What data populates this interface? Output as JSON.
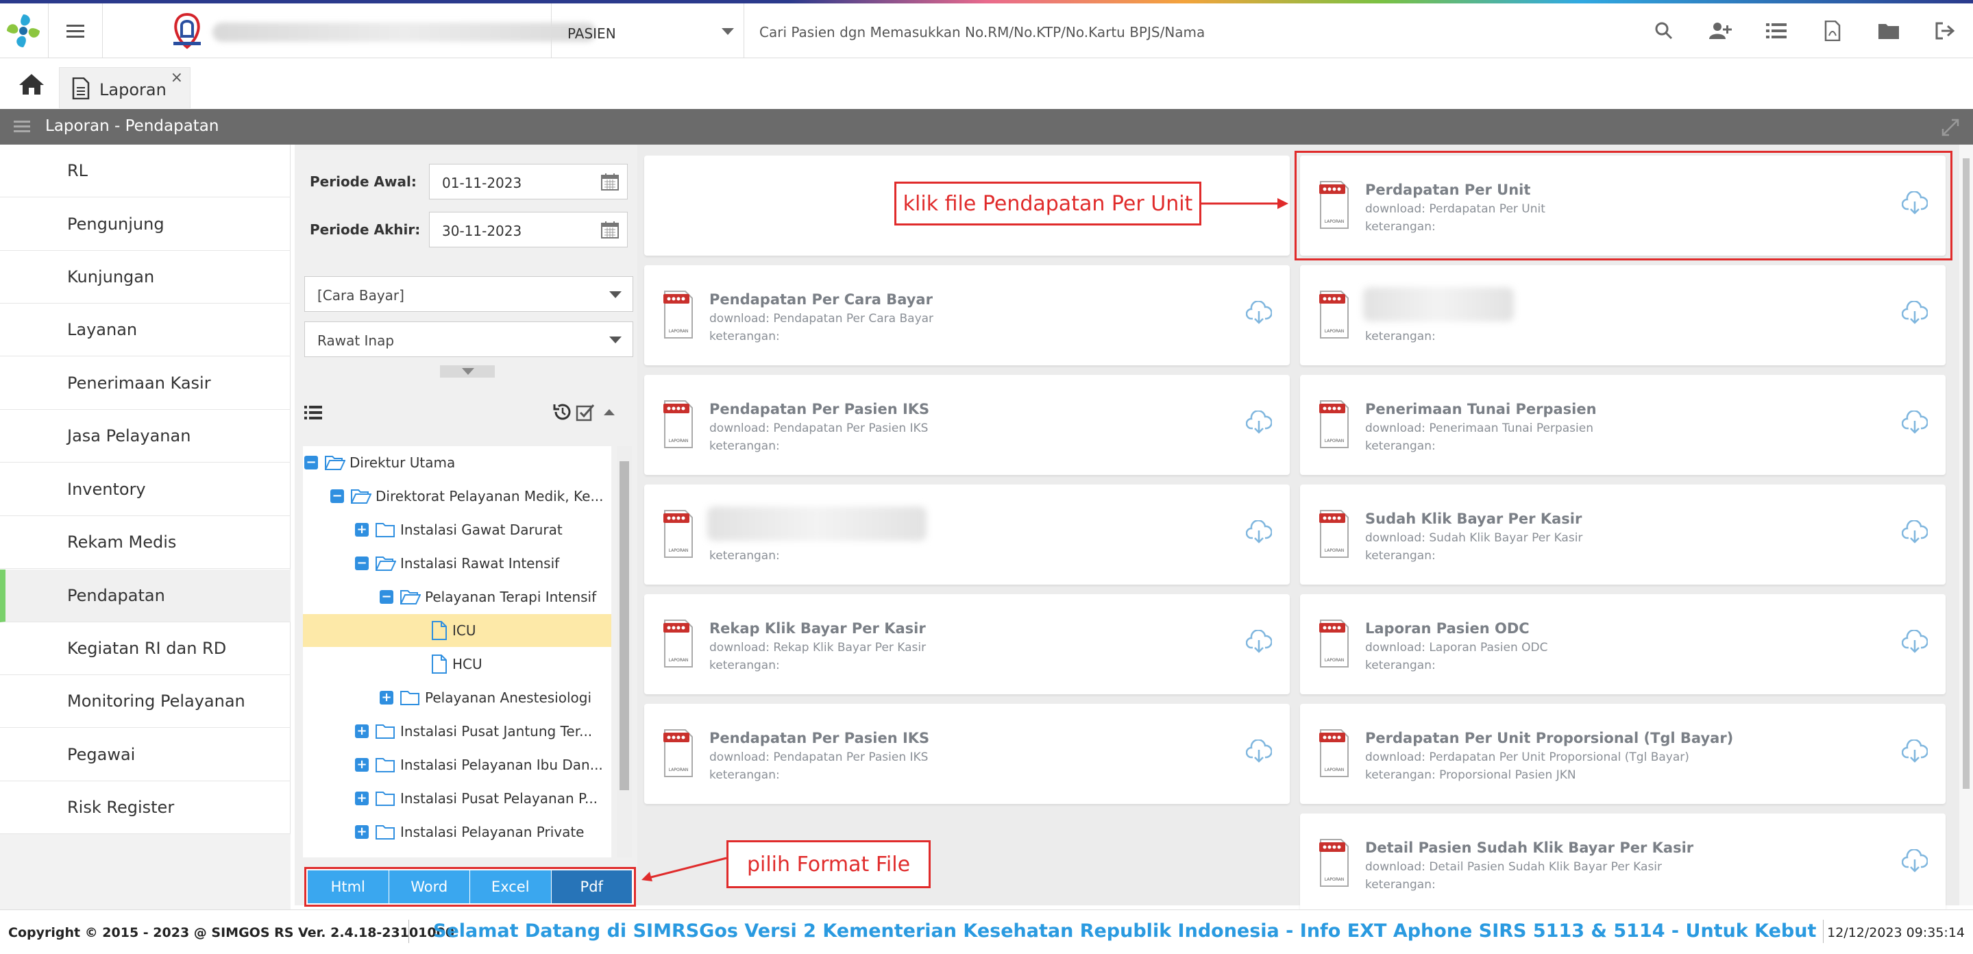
{
  "header": {
    "patient_type": "PASIEN",
    "search_placeholder": "Cari Pasien dgn Memasukkan No.RM/No.KTP/No.Kartu BPJS/Nama"
  },
  "tabs": [
    {
      "label": "Laporan",
      "close": "×"
    }
  ],
  "title_bar": "Laporan - Pendapatan",
  "nav": [
    "RL",
    "Pengunjung",
    "Kunjungan",
    "Layanan",
    "Penerimaan Kasir",
    "Jasa Pelayanan",
    "Inventory",
    "Rekam Medis",
    "Pendapatan",
    "Kegiatan RI dan RD",
    "Monitoring Pelayanan",
    "Pegawai",
    "Risk Register"
  ],
  "nav_active": "Pendapatan",
  "filter": {
    "periode_awal_label": "Periode Awal:",
    "periode_awal_value": "01-11-2023",
    "periode_akhir_label": "Periode Akhir:",
    "periode_akhir_value": "30-11-2023",
    "cara_bayar": "[Cara Bayar]",
    "jenis_rawat": "Rawat Inap"
  },
  "tree": [
    {
      "label": "Direktur Utama",
      "sign": "−"
    },
    {
      "label": "Direktorat Pelayanan Medik, Ke...",
      "sign": "−"
    },
    {
      "label": "Instalasi Gawat Darurat",
      "sign": "+"
    },
    {
      "label": "Instalasi Rawat Intensif",
      "sign": "−"
    },
    {
      "label": "Pelayanan Terapi Intensif",
      "sign": "−"
    },
    {
      "label": "ICU",
      "sign": ""
    },
    {
      "label": "HCU",
      "sign": ""
    },
    {
      "label": "Pelayanan Anestesiologi",
      "sign": "+"
    },
    {
      "label": "Instalasi Pusat Jantung Ter...",
      "sign": "+"
    },
    {
      "label": "Instalasi Pelayanan Ibu Dan...",
      "sign": "+"
    },
    {
      "label": "Instalasi Pusat Pelayanan P...",
      "sign": "+"
    },
    {
      "label": "Instalasi Pelayanan Private",
      "sign": "+"
    }
  ],
  "formats": [
    "Html",
    "Word",
    "Excel",
    "Pdf"
  ],
  "active_format": "Pdf",
  "pdf_icon_text": "LAPORAN",
  "reports": [
    {
      "title": "Perdapatan Per Unit",
      "download": "download: Perdapatan Per Unit",
      "keterangan": "keterangan:"
    },
    {
      "title": "Pendapatan Per Cara Bayar",
      "download": "download: Pendapatan Per Cara Bayar",
      "keterangan": "keterangan:"
    },
    {
      "title": "",
      "download": "",
      "keterangan": "keterangan:"
    },
    {
      "title": "Pendapatan Per Pasien IKS",
      "download": "download: Pendapatan Per Pasien IKS",
      "keterangan": "keterangan:"
    },
    {
      "title": "Penerimaan Tunai Perpasien",
      "download": "download: Penerimaan Tunai Perpasien",
      "keterangan": "keterangan:"
    },
    {
      "title": "",
      "download": "",
      "keterangan": "keterangan:"
    },
    {
      "title": "Sudah Klik Bayar Per Kasir",
      "download": "download: Sudah Klik Bayar Per Kasir",
      "keterangan": "keterangan:"
    },
    {
      "title": "Rekap Klik Bayar Per Kasir",
      "download": "download: Rekap Klik Bayar Per Kasir",
      "keterangan": "keterangan:"
    },
    {
      "title": "Laporan Pasien ODC",
      "download": "download: Laporan Pasien ODC",
      "keterangan": "keterangan:"
    },
    {
      "title": "Pendapatan Per Pasien IKS",
      "download": "download: Pendapatan Per Pasien IKS",
      "keterangan": "keterangan:"
    },
    {
      "title": "Perdapatan Per Unit Proporsional (Tgl Bayar)",
      "download": "download: Perdapatan Per Unit Proporsional (Tgl Bayar)",
      "keterangan": "keterangan: Proporsional Pasien JKN"
    },
    {
      "title": "Detail Pasien Sudah Klik Bayar Per Kasir",
      "download": "download: Detail Pasien Sudah Klik Bayar Per Kasir",
      "keterangan": "keterangan:"
    }
  ],
  "annotations": {
    "click_hint": "klik file Pendapatan Per Unit",
    "format_hint": "pilih Format File"
  },
  "footer": {
    "copyright": "Copyright © 2015 - 2023 @ SIMGOS RS Ver. 2.4.18-23101000",
    "marquee": "Selamat Datang di SIMRSGos Versi 2 Kementerian Kesehatan Republik Indonesia - Info EXT Aphone SIRS 5113 & 5114 - Untuk Kebutuhan Terkait Har",
    "datetime": "12/12/2023 09:35:14"
  },
  "colors": {
    "accent": "#2f8fe0",
    "format_button": "#3aa7ef",
    "format_active": "#2774b8",
    "annotation": "#e02b2b",
    "nav_active_marker": "#7ad16b",
    "title_bar": "#6b6b6b"
  }
}
